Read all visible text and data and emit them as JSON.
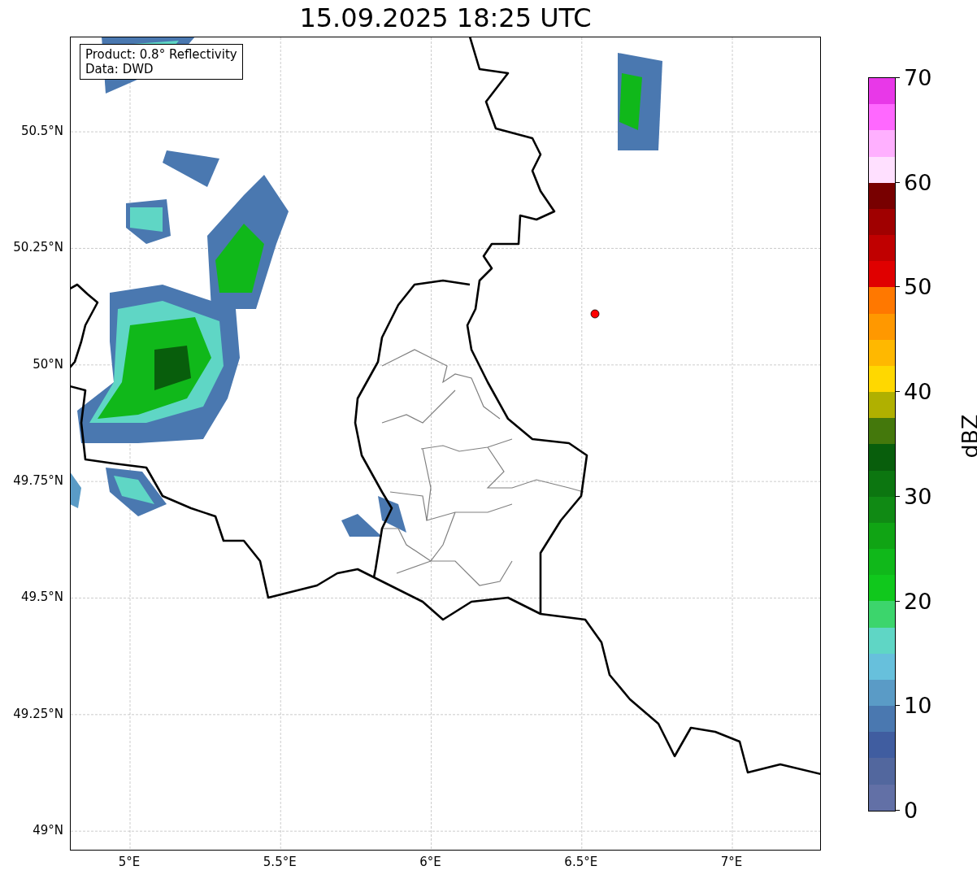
{
  "title": "15.09.2025 18:25 UTC",
  "legend": [
    "Product: 0.8° Reflectivity",
    "Data: DWD"
  ],
  "map": {
    "lat_labels": [
      "50.5°N",
      "50.25°N",
      "50°N",
      "49.75°N",
      "49.5°N",
      "49.25°N",
      "49°N"
    ],
    "lon_labels": [
      "5°E",
      "5.5°E",
      "6°E",
      "6.5°E",
      "7°E"
    ]
  },
  "colorbar": {
    "label": "dBZ",
    "ticks": [
      "70",
      "60",
      "50",
      "40",
      "30",
      "20",
      "10",
      "0"
    ],
    "segments": [
      {
        "color": "#e838e8"
      },
      {
        "color": "#ff68ff"
      },
      {
        "color": "#ffb0ff"
      },
      {
        "color": "#ffe0ff"
      },
      {
        "color": "#780000"
      },
      {
        "color": "#a00000"
      },
      {
        "color": "#c00000"
      },
      {
        "color": "#e00000"
      },
      {
        "color": "#ff7800"
      },
      {
        "color": "#ff9800"
      },
      {
        "color": "#ffb800"
      },
      {
        "color": "#ffd800"
      },
      {
        "color": "#b0b000"
      },
      {
        "color": "#44780c"
      },
      {
        "color": "#085e0c"
      },
      {
        "color": "#0c7610"
      },
      {
        "color": "#108a14"
      },
      {
        "color": "#10a414"
      },
      {
        "color": "#10b81a"
      },
      {
        "color": "#10c81c"
      },
      {
        "color": "#3cd56c"
      },
      {
        "color": "#5fd6c5"
      },
      {
        "color": "#67c0dc"
      },
      {
        "color": "#5a9bc6"
      },
      {
        "color": "#4a78b0"
      },
      {
        "color": "#405da0"
      },
      {
        "color": "#52679e"
      },
      {
        "color": "#6270a6"
      }
    ]
  }
}
